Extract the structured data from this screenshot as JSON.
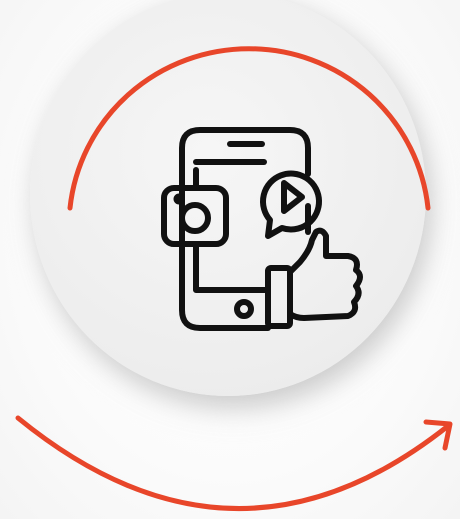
{
  "illustration": {
    "accent_color": "#e8462a",
    "icon_color": "#111111",
    "circle_color": "#eeeeee",
    "icon": "social-media-phone-icon",
    "sub_icons": [
      "camera-icon",
      "play-icon",
      "thumbs-up-icon"
    ]
  }
}
